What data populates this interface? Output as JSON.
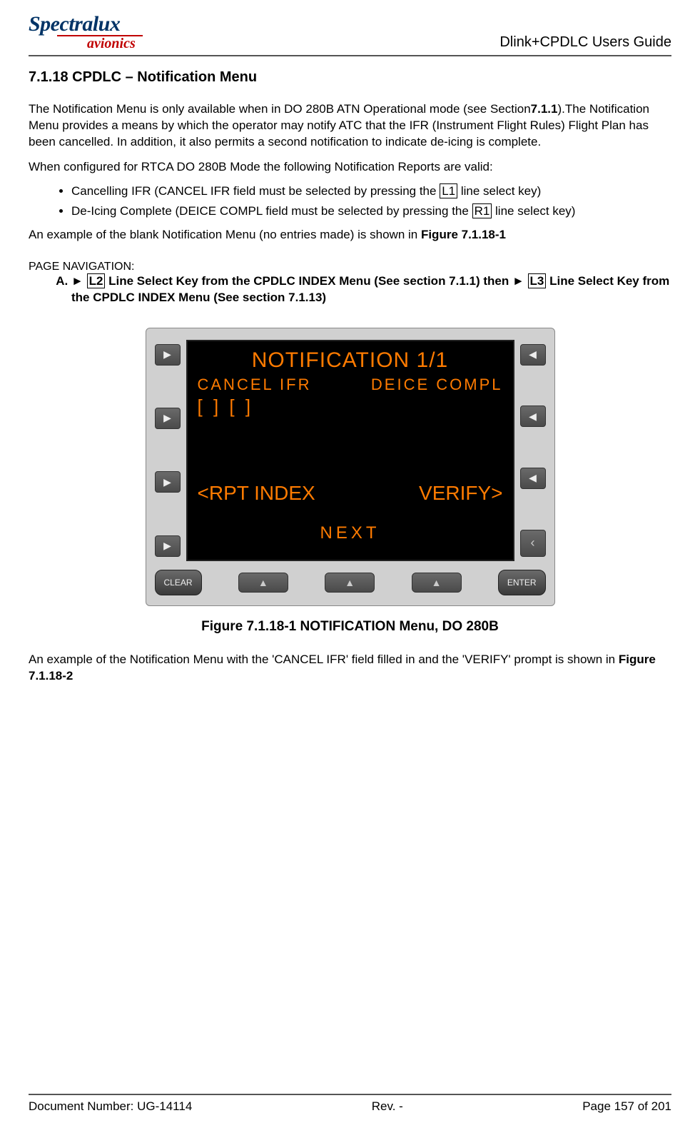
{
  "header": {
    "logo_main": "Spectralux",
    "logo_sub": "avionics",
    "doc_title": "Dlink+CPDLC Users Guide"
  },
  "section": {
    "number": "7.1.18",
    "title": "CPDLC – Notification Menu"
  },
  "paragraphs": {
    "p1_a": "The Notification Menu is only available when in DO 280B ATN Operational mode (see Section",
    "p1_ref": "7.1.1",
    "p1_b": ").The Notification Menu provides a means by which the operator may notify ATC that the IFR (Instrument Flight Rules) Flight Plan has been cancelled. In addition, it also permits a second notification to indicate de-icing is complete.",
    "p2": "When configured for RTCA DO 280B Mode the following Notification Reports are valid:",
    "p3_a": "An example of the blank Notification Menu (no entries made) is shown in ",
    "p3_ref": "Figure 7.1.18-1",
    "p4_a": "An example of the Notification Menu with the 'CANCEL IFR' field filled in and the 'VERIFY' prompt is shown in ",
    "p4_ref": "Figure 7.1.18-2"
  },
  "bullets": {
    "b1_a": "Cancelling IFR (CANCEL IFR field must be selected by pressing the ",
    "b1_key": "L1",
    "b1_b": " line select key)",
    "b2_a": "De-Icing Complete (DEICE COMPL field must be selected by pressing the ",
    "b2_key": "R1",
    "b2_b": " line select key)"
  },
  "nav": {
    "label": "PAGE NAVIGATION:",
    "a_1": "► ",
    "a_key1": "L2",
    "a_2": " Line Select Key from the CPDLC INDEX Menu (See section 7.1.1) then ► ",
    "a_key2": "L3",
    "a_3": " Line Select Key from the CPDLC INDEX Menu (See section 7.1.13)"
  },
  "screen": {
    "title": "NOTIFICATION   1/1",
    "label_left": "CANCEL IFR",
    "label_right": "DEICE COMPL",
    "brackets": "[      ]   [      ]",
    "nav_left": "<RPT INDEX",
    "nav_right": "VERIFY>",
    "next": "NEXT"
  },
  "device_buttons": {
    "clear": "CLEAR",
    "enter": "ENTER",
    "play": "▶",
    "left": "◀",
    "right": "▶",
    "up": "▲",
    "chev": "‹"
  },
  "figure": {
    "caption": "Figure 7.1.18-1 NOTIFICATION Menu, DO 280B"
  },
  "footer": {
    "docnum": "Document Number:  UG-14114",
    "rev": "Rev. -",
    "page": "Page 157 of 201"
  }
}
